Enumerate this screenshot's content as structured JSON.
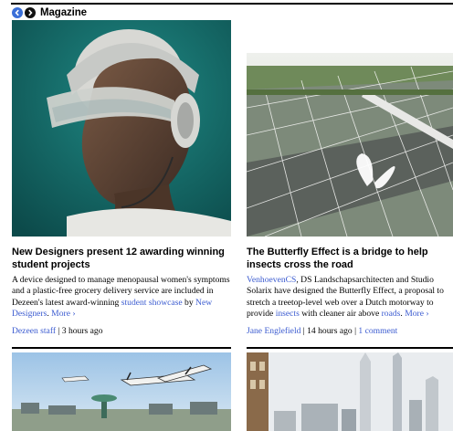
{
  "section": {
    "title": "Magazine",
    "prev_icon": "chevron-left-icon",
    "next_icon": "chevron-right-icon"
  },
  "articles": [
    {
      "title": "New Designers present 12 awarding winning student projects",
      "excerpt": {
        "t1": "A device designed to manage menopausal women's symptoms and a plastic-free grocery delivery service are included in Dezeen's latest award-winning ",
        "l1": "student showcase",
        "t2": " by ",
        "l2": "New Designers",
        "t3": ". ",
        "more": "More ›"
      },
      "author": "Dezeen staff",
      "sep": " | ",
      "time": "3 hours ago"
    },
    {
      "title": "The Butterfly Effect is a bridge to help insects cross the road",
      "excerpt": {
        "l1": "VenhoevenCS",
        "t1": ", DS Landschapsarchitecten and Studio Solarix have designed the Butterfly Effect, a proposal to stretch a treetop-level web over a Dutch motorway to provide ",
        "l2": "insects",
        "t2": " with cleaner air above ",
        "l3": "roads",
        "t3": ". ",
        "more": "More ›"
      },
      "author": "Jane Englefield",
      "sep": " | ",
      "time": "14 hours ago",
      "sep2": " | ",
      "comments": "1 comment"
    }
  ]
}
